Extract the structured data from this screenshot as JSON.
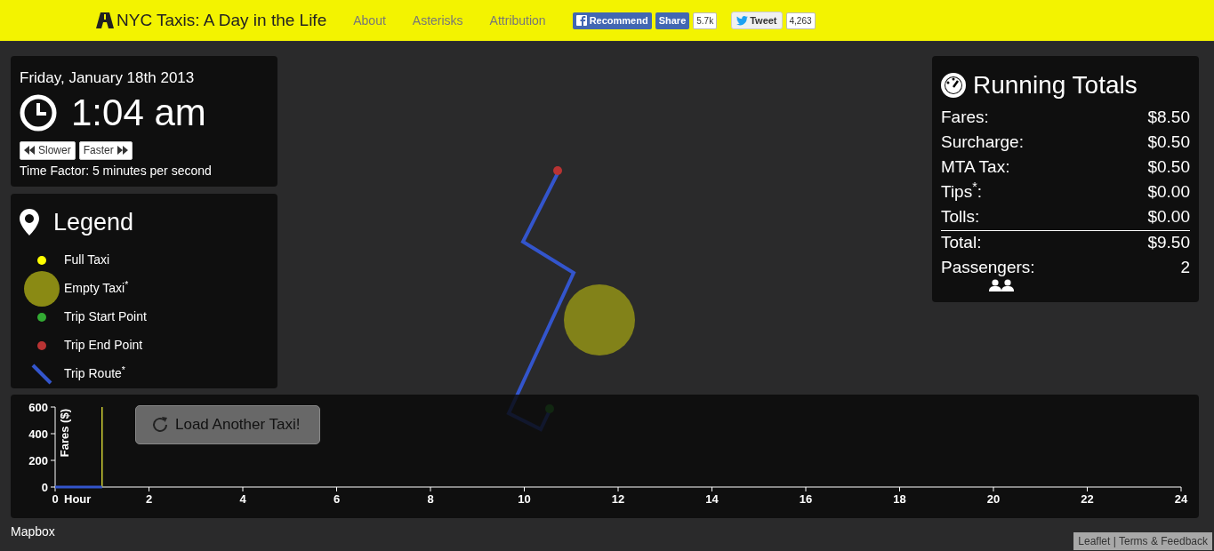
{
  "navbar": {
    "brand": "NYC Taxis: A Day in the Life",
    "links": [
      "About",
      "Asterisks",
      "Attribution"
    ]
  },
  "social": {
    "recommend": "Recommend",
    "share": "Share",
    "share_count": "5.7k",
    "tweet": "Tweet",
    "tweet_count": "4,263"
  },
  "clock": {
    "date": "Friday, January 18th 2013",
    "time": "1:04 am",
    "buttons": [
      {
        "kind": "slower",
        "label": "Slower"
      },
      {
        "kind": "faster",
        "label": "Faster"
      }
    ],
    "time_factor": "Time Factor: 5 minutes per second"
  },
  "legend": {
    "title": "Legend",
    "items": [
      {
        "kind": "dot",
        "label": "Full Taxi",
        "color": "#ffff00"
      },
      {
        "kind": "circle",
        "label": "Empty Taxi$^{*}$",
        "color": "#8a8a14"
      },
      {
        "kind": "dot",
        "label": "Trip Start Point",
        "color": "#33aa33"
      },
      {
        "kind": "dot",
        "label": "Trip End Point",
        "color": "#b83333"
      },
      {
        "kind": "line",
        "label": "Trip Route$^{*}$",
        "color": "#3355cc"
      }
    ]
  },
  "totals": {
    "title": "Running Totals",
    "rows": [
      {
        "kind": "item",
        "label": "Fares:",
        "value": "$8.50"
      },
      {
        "kind": "item",
        "label": "Surcharge:",
        "value": "$0.50"
      },
      {
        "kind": "item",
        "label": "MTA Tax:",
        "value": "$0.50"
      },
      {
        "kind": "item",
        "label": "Tips$^{*}$:",
        "value": "$0.00"
      },
      {
        "kind": "item",
        "label": "Tolls:",
        "value": "$0.00"
      },
      {
        "kind": "total",
        "label": "Total:",
        "value": "$9.50"
      },
      {
        "kind": "count",
        "label": "Passengers:",
        "value": "2"
      }
    ]
  },
  "load_button": "Load Another Taxi!",
  "chart": {
    "chart_data": {
      "type": "line",
      "xlabel": "Hour",
      "ylabel": "Fares ($)",
      "xlim": [
        0,
        24
      ],
      "ylim": [
        0,
        600
      ],
      "xticks": [
        0,
        2,
        4,
        6,
        8,
        10,
        12,
        14,
        16,
        18,
        20,
        22,
        24
      ],
      "yticks": [
        0,
        200,
        400,
        600
      ],
      "x": [
        0,
        1
      ],
      "values": [
        0,
        0
      ],
      "ref_lines": [
        {
          "axis": "x",
          "value": 1
        }
      ]
    }
  },
  "attribution": {
    "mapbox": "Mapbox",
    "leaflet": "Leaflet",
    "separator": "|",
    "terms": "Terms & Feedback"
  }
}
